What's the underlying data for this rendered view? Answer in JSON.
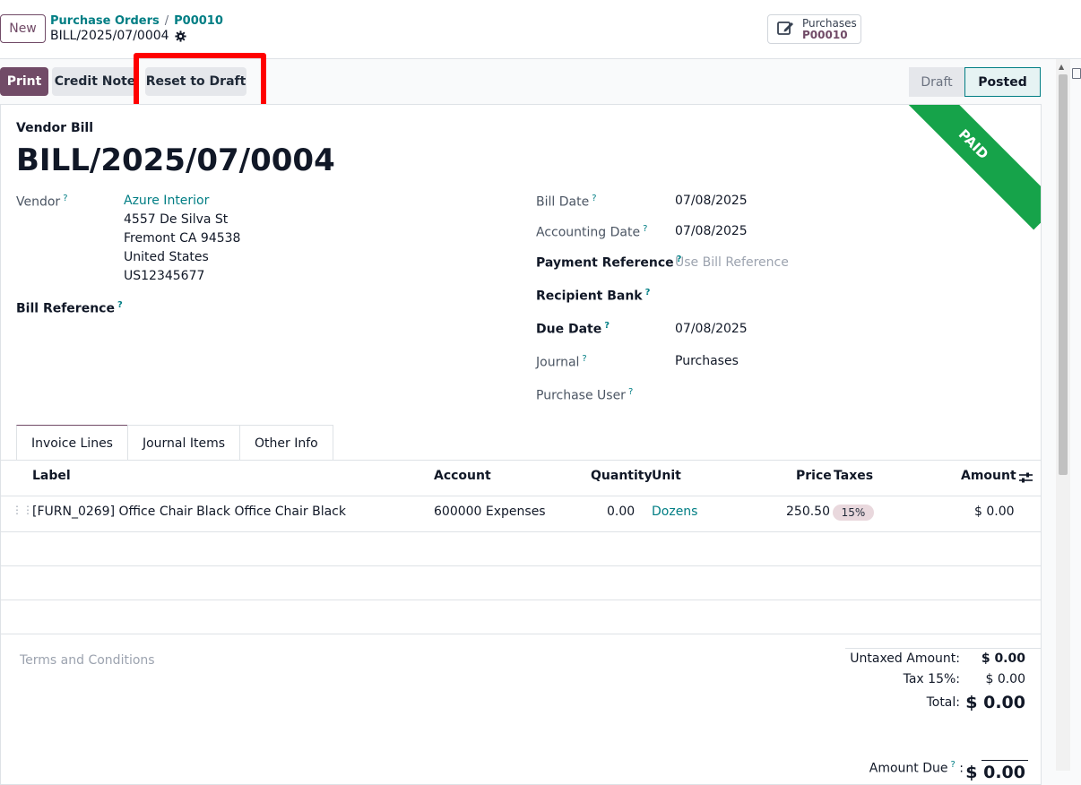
{
  "topbar": {
    "new_label": "New",
    "breadcrumb": [
      {
        "label": "Purchase Orders"
      },
      {
        "label": "P00010"
      }
    ],
    "breadcrumb_sep": "/",
    "record_name": "BILL/2025/07/0004",
    "smart_button": {
      "label": "Purchases",
      "value": "P00010",
      "icon": "edit-icon"
    }
  },
  "actions": {
    "print_label": "Print",
    "credit_note_label": "Credit Note",
    "reset_label": "Reset to Draft"
  },
  "status": {
    "stages": [
      "Draft",
      "Posted"
    ],
    "current": "Posted"
  },
  "ribbon": {
    "text": "PAID",
    "color": "#16a34a"
  },
  "form": {
    "type_label": "Vendor Bill",
    "title": "BILL/2025/07/0004",
    "vendor_label": "Vendor",
    "vendor_name": "Azure Interior",
    "vendor_address": [
      "4557 De Silva St",
      "Fremont CA 94538",
      "United States",
      "US12345677"
    ],
    "bill_reference_label": "Bill Reference",
    "help_mark": "?",
    "right": [
      {
        "label": "Bill Date",
        "value": "07/08/2025"
      },
      {
        "label": "Accounting Date",
        "value": "07/08/2025"
      },
      {
        "label": "Payment Reference",
        "placeholder": "Use Bill Reference"
      },
      {
        "label": "Recipient Bank",
        "value": ""
      },
      {
        "label": "Due Date",
        "value": "07/08/2025"
      },
      {
        "label": "Journal",
        "value": "Purchases"
      },
      {
        "label": "Purchase User",
        "value": ""
      }
    ]
  },
  "tabs": [
    "Invoice Lines",
    "Journal Items",
    "Other Info"
  ],
  "table": {
    "headers": [
      "Label",
      "Account",
      "Quantity",
      "Unit",
      "Price",
      "Taxes",
      "Amount"
    ],
    "rows": [
      {
        "label": "[FURN_0269] Office Chair Black Office Chair Black",
        "account": "600000 Expenses",
        "quantity": "0.00",
        "unit": "Dozens",
        "price": "250.50",
        "taxes": "15%",
        "amount": "$ 0.00"
      }
    ]
  },
  "footer": {
    "terms_placeholder": "Terms and Conditions",
    "untaxed_label": "Untaxed Amount:",
    "untaxed_value": "$ 0.00",
    "tax_label": "Tax 15%:",
    "tax_value": "$ 0.00",
    "total_label": "Total:",
    "total_value": "$ 0.00",
    "amount_due_label": "Amount Due",
    "amount_due_value": "$ 0.00"
  },
  "colors": {
    "brand": "#714b67",
    "link": "#017e84",
    "paid": "#16a34a",
    "highlight": "#ff0000"
  }
}
